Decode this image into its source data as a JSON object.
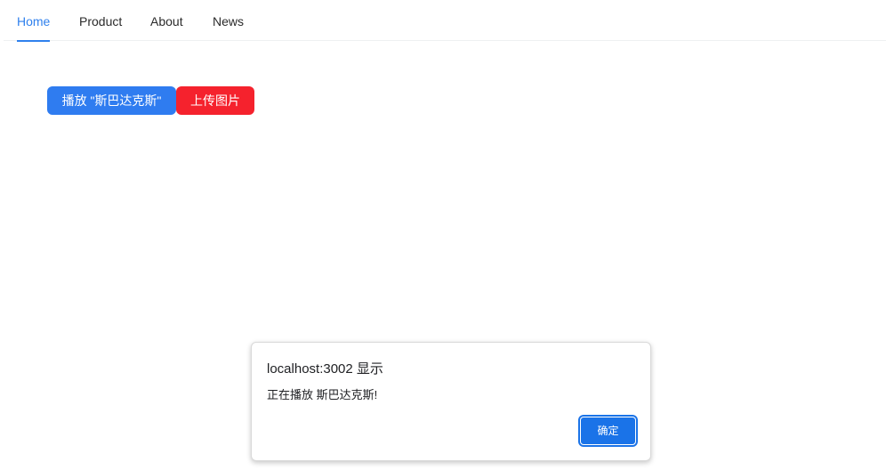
{
  "nav": {
    "items": [
      {
        "label": "Home",
        "active": true
      },
      {
        "label": "Product",
        "active": false
      },
      {
        "label": "About",
        "active": false
      },
      {
        "label": "News",
        "active": false
      }
    ]
  },
  "actions": {
    "play_label": "播放 \"斯巴达克斯\"",
    "upload_label": "上传图片"
  },
  "dialog": {
    "title": "localhost:3002 显示",
    "message": "正在播放 斯巴达克斯!",
    "ok_label": "确定"
  },
  "colors": {
    "accent": "#2f80ed",
    "play_button": "#2f7cf0",
    "upload_button": "#f5222d",
    "dialog_ok": "#1a73e8"
  }
}
